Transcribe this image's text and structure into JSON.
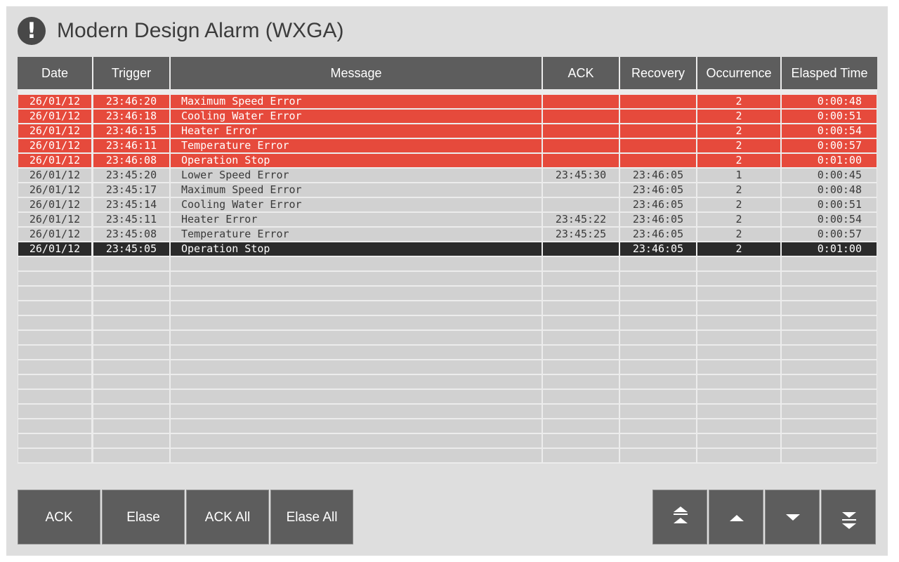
{
  "window": {
    "title": "Modern Design Alarm (WXGA)",
    "icon": "exclamation-icon",
    "icon_glyph": "!"
  },
  "table": {
    "columns": [
      "Date",
      "Trigger",
      "Message",
      "ACK",
      "Recovery",
      "Occurrence",
      "Elasped Time"
    ],
    "rows": [
      {
        "state": "active",
        "date": "26/01/12",
        "trigger": "23:46:20",
        "message": "Maximum Speed Error",
        "ack": "",
        "recovery": "",
        "occurrence": "2",
        "elapsed": "0:00:48"
      },
      {
        "state": "active",
        "date": "26/01/12",
        "trigger": "23:46:18",
        "message": "Cooling Water Error",
        "ack": "",
        "recovery": "",
        "occurrence": "2",
        "elapsed": "0:00:51"
      },
      {
        "state": "active",
        "date": "26/01/12",
        "trigger": "23:46:15",
        "message": "Heater Error",
        "ack": "",
        "recovery": "",
        "occurrence": "2",
        "elapsed": "0:00:54"
      },
      {
        "state": "active",
        "date": "26/01/12",
        "trigger": "23:46:11",
        "message": "Temperature Error",
        "ack": "",
        "recovery": "",
        "occurrence": "2",
        "elapsed": "0:00:57"
      },
      {
        "state": "active",
        "date": "26/01/12",
        "trigger": "23:46:08",
        "message": "Operation Stop",
        "ack": "",
        "recovery": "",
        "occurrence": "2",
        "elapsed": "0:01:00"
      },
      {
        "state": "normal",
        "date": "26/01/12",
        "trigger": "23:45:20",
        "message": "Lower Speed Error",
        "ack": "23:45:30",
        "recovery": "23:46:05",
        "occurrence": "1",
        "elapsed": "0:00:45"
      },
      {
        "state": "normal",
        "date": "26/01/12",
        "trigger": "23:45:17",
        "message": "Maximum Speed Error",
        "ack": "",
        "recovery": "23:46:05",
        "occurrence": "2",
        "elapsed": "0:00:48"
      },
      {
        "state": "normal",
        "date": "26/01/12",
        "trigger": "23:45:14",
        "message": "Cooling Water Error",
        "ack": "",
        "recovery": "23:46:05",
        "occurrence": "2",
        "elapsed": "0:00:51"
      },
      {
        "state": "normal",
        "date": "26/01/12",
        "trigger": "23:45:11",
        "message": "Heater Error",
        "ack": "23:45:22",
        "recovery": "23:46:05",
        "occurrence": "2",
        "elapsed": "0:00:54"
      },
      {
        "state": "normal",
        "date": "26/01/12",
        "trigger": "23:45:08",
        "message": "Temperature Error",
        "ack": "23:45:25",
        "recovery": "23:46:05",
        "occurrence": "2",
        "elapsed": "0:00:57"
      },
      {
        "state": "selected",
        "date": "26/01/12",
        "trigger": "23:45:05",
        "message": "Operation Stop",
        "ack": "",
        "recovery": "23:46:05",
        "occurrence": "2",
        "elapsed": "0:01:00"
      }
    ],
    "empty_rows": 14
  },
  "buttons": {
    "ack": "ACK",
    "erase": "Elase",
    "ack_all": "ACK All",
    "erase_all": "Elase All"
  },
  "navigation": {
    "first": "double-chevron-up-icon",
    "up": "triangle-up-icon",
    "down": "triangle-down-icon",
    "last": "double-chevron-down-icon"
  },
  "colors": {
    "panel": "#dedede",
    "header": "#5d5d5d",
    "alarm_active": "#e64a3c",
    "row_normal": "#d1d1d1",
    "row_selected": "#2b2b2b",
    "button": "#5d5d5d"
  }
}
